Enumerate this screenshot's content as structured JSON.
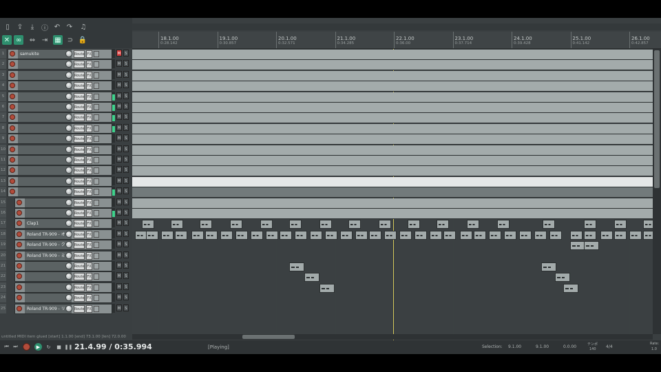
{
  "toolbar": {
    "icons": [
      "new-file-icon",
      "open-icon",
      "save-icon",
      "info-icon",
      "undo-icon",
      "redo-icon",
      "metronome-icon",
      "ripple-icon",
      "loop-icon",
      "grid-icon",
      "snap-icon",
      "lock-icon"
    ]
  },
  "ruler": {
    "markers": [
      {
        "measure": "18.1.00",
        "time": "0:28.142"
      },
      {
        "measure": "19.1.00",
        "time": "0:30.857"
      },
      {
        "measure": "20.1.00",
        "time": "0:32.571"
      },
      {
        "measure": "21.1.00",
        "time": "0:34.285"
      },
      {
        "measure": "22.1.00",
        "time": "0:36.00"
      },
      {
        "measure": "23.1.00",
        "time": "0:37.714"
      },
      {
        "measure": "24.1.00",
        "time": "0:39.428"
      },
      {
        "measure": "25.1.00",
        "time": "0:41.142"
      },
      {
        "measure": "26.1.00",
        "time": "0:42.857"
      }
    ]
  },
  "tracks": [
    {
      "num": "1",
      "name": "samukite",
      "depth": 0,
      "muted": true
    },
    {
      "num": "2",
      "name": "",
      "depth": 0
    },
    {
      "num": "3",
      "name": "",
      "depth": 0
    },
    {
      "num": "4",
      "name": "",
      "depth": 0
    },
    {
      "num": "5",
      "name": "",
      "depth": 0
    },
    {
      "num": "6",
      "name": "",
      "depth": 0
    },
    {
      "num": "7",
      "name": "",
      "depth": 0
    },
    {
      "num": "8",
      "name": "",
      "depth": 0
    },
    {
      "num": "9",
      "name": "",
      "depth": 0
    },
    {
      "num": "10",
      "name": "",
      "depth": 0
    },
    {
      "num": "11",
      "name": "",
      "depth": 0
    },
    {
      "num": "12",
      "name": "",
      "depth": 0
    },
    {
      "num": "13",
      "name": "",
      "depth": 0,
      "selected": true
    },
    {
      "num": "14",
      "name": "",
      "depth": 0,
      "folder": true
    },
    {
      "num": "15",
      "name": "",
      "depth": 1
    },
    {
      "num": "16",
      "name": "",
      "depth": 1
    },
    {
      "num": "17",
      "name": "Clap1",
      "depth": 1
    },
    {
      "num": "18",
      "name": "Roland TR-909 - オープンハイ",
      "depth": 1
    },
    {
      "num": "19",
      "name": "Roland TR-909 - クラッシュ",
      "depth": 1
    },
    {
      "num": "20",
      "name": "Roland TR-909 - ミッドタム",
      "depth": 1
    },
    {
      "num": "21",
      "name": "",
      "depth": 1
    },
    {
      "num": "22",
      "name": "",
      "depth": 1
    },
    {
      "num": "23",
      "name": "",
      "depth": 1
    },
    {
      "num": "24",
      "name": "",
      "depth": 1
    },
    {
      "num": "25",
      "name": "Roland TR-909 - リムショット",
      "depth": 1
    }
  ],
  "track_labels": {
    "route": "Route",
    "fx": "FX",
    "mute": "M",
    "solo": "S"
  },
  "status_line": "untitled MIDI item glued [start] 1.1.00 [end] 73.1.00 [len] 72.0.00",
  "transport": {
    "time": "21.4.99 / 0:35.994",
    "state": "[Playing]",
    "selection_label": "Selection:",
    "sel_start": "9.1.00",
    "sel_end": "9.1.00",
    "sel_len": "0.0.00",
    "tempo_label": "テンポ",
    "tempo": "140",
    "signature": "4/4",
    "rate_label": "Rate:",
    "rate": "1.0"
  }
}
